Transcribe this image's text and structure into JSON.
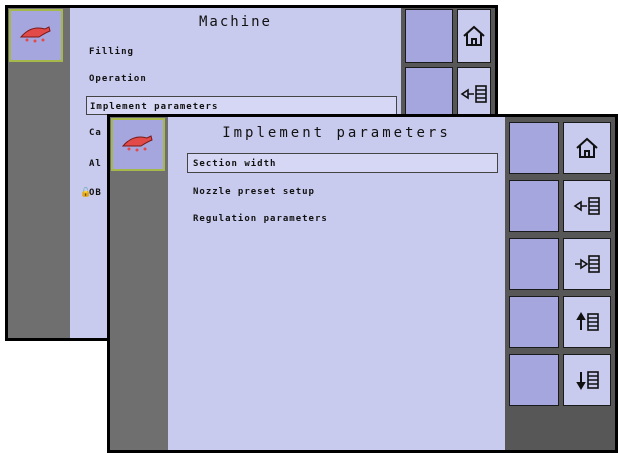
{
  "back_screen": {
    "title": "Machine",
    "menu": [
      {
        "label": "Filling"
      },
      {
        "label": "Operation"
      },
      {
        "label": "Implement parameters"
      },
      {
        "label": "Ca"
      },
      {
        "label": "Al"
      },
      {
        "label": "OB"
      }
    ]
  },
  "front_screen": {
    "title": "Implement parameters",
    "menu": [
      {
        "label": "Section width"
      },
      {
        "label": "Nozzle preset setup"
      },
      {
        "label": "Regulation parameters"
      }
    ]
  },
  "icons": {
    "logo": "sprayer-logo-icon",
    "home": "home-icon",
    "back": "back-list-icon",
    "forward": "forward-list-icon",
    "up": "up-list-icon",
    "down": "down-list-icon",
    "lock": "lock-icon"
  },
  "colors": {
    "panel": "#c9cbee",
    "button": "#a6a6de",
    "logo_border": "#a6b84a",
    "left_column": "#6f6f6f",
    "right_column": "#575757"
  }
}
